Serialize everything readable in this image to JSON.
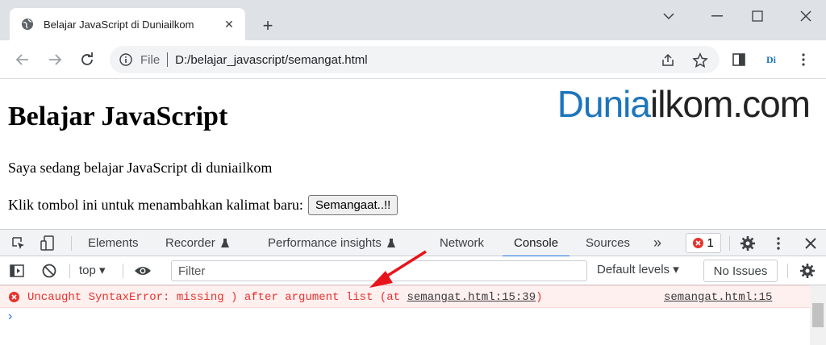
{
  "browser": {
    "tab_title": "Belajar JavaScript di Duniailkom",
    "new_tab": "+",
    "url_scheme": "File",
    "url": "D:/belajar_javascript/semangat.html",
    "extension_label": "Di"
  },
  "page": {
    "heading": "Belajar JavaScript",
    "paragraph": "Saya sedang belajar JavaScript di duniailkom",
    "prompt_text": "Klik tombol ini untuk menambahkan kalimat baru:",
    "button_label": "Semangaat..!!",
    "logo_part1": "Dunia",
    "logo_part2": "ilkom.com"
  },
  "devtools": {
    "tabs": [
      "Elements",
      "Recorder",
      "Performance insights",
      "Network",
      "Console",
      "Sources"
    ],
    "more": "»",
    "active_tab": "Console",
    "error_count": "1",
    "context": "top",
    "filter_placeholder": "Filter",
    "levels": "Default levels",
    "issues": "No Issues",
    "error_message": "Uncaught SyntaxError: missing ) after argument list (at ",
    "error_link": "semangat.html:15:39",
    "error_close": ")",
    "error_source": "semangat.html:15",
    "prompt": "›"
  },
  "colors": {
    "accent": "#1a73e8",
    "error": "#e8312b",
    "logo_blue": "#1c75bc"
  }
}
